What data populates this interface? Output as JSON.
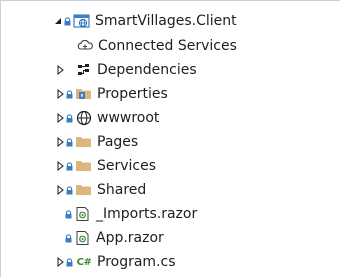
{
  "solution_explorer": {
    "project": {
      "label": "SmartVillages.Client",
      "expanded": true
    },
    "items": [
      {
        "label": "Connected Services",
        "icon": "connected-services-icon",
        "expander": "none"
      },
      {
        "label": "Dependencies",
        "icon": "dependencies-icon",
        "expander": "collapsed"
      },
      {
        "label": "Properties",
        "icon": "properties-folder-icon",
        "expander": "collapsed"
      },
      {
        "label": "wwwroot",
        "icon": "globe-icon",
        "expander": "collapsed"
      },
      {
        "label": "Pages",
        "icon": "folder-icon",
        "expander": "collapsed"
      },
      {
        "label": "Services",
        "icon": "folder-icon",
        "expander": "collapsed"
      },
      {
        "label": "Shared",
        "icon": "folder-icon",
        "expander": "collapsed"
      },
      {
        "label": "_Imports.razor",
        "icon": "razor-file-icon",
        "expander": "none"
      },
      {
        "label": "App.razor",
        "icon": "razor-file-icon",
        "expander": "none"
      },
      {
        "label": "Program.cs",
        "icon": "csharp-file-icon",
        "icon_text": "C#",
        "expander": "collapsed"
      }
    ],
    "colors": {
      "lock": "#3c7fc4",
      "folder": "#dcb67a",
      "globe": "#1e1e1e",
      "csharp": "#388a34",
      "razor_border": "#388a34",
      "text": "#1e1e1e"
    }
  }
}
